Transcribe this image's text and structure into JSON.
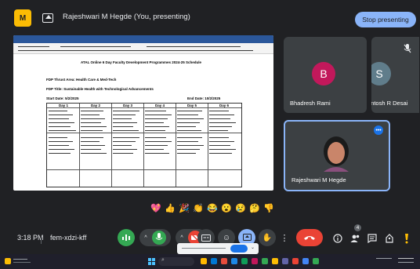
{
  "header": {
    "app_logo_text": "M",
    "presenter_title": "Rajeshwari M Hegde (You, presenting)",
    "stop_presenting_label": "Stop presenting"
  },
  "document": {
    "title": "ATAL Online 6 Day Faculty Development Programmes 2024-25 Schedule",
    "thrust_area": "FDP Thrust Area: Health Care & Med-Tech",
    "fdp_title": "FDP Title: Sustainable Health with Technological Advancements",
    "start_date": "Start Date: 5/2/2025",
    "end_date": "End Date: 10/2/2025",
    "days": [
      "Day 1",
      "Day 2",
      "Day 3",
      "Day 4",
      "Day 5",
      "Day 6"
    ]
  },
  "participants": [
    {
      "name": "Bhadresh Rami",
      "initial": "B",
      "color": "#c2185b"
    },
    {
      "name": "Santosh R Desai",
      "initial": "S",
      "color": "#607d8b"
    },
    {
      "name": "Rajeshwari M Hegde",
      "initial": "",
      "color": "#3c4043"
    }
  ],
  "reactions": [
    "💖",
    "👍",
    "🎉",
    "👏",
    "😂",
    "😮",
    "😢",
    "🤔",
    "👎"
  ],
  "meeting": {
    "time": "3:18 PM",
    "code": "fem-xdzi-kff",
    "participant_count": "4"
  },
  "colors": {
    "accent": "#8ab4f8",
    "end_call": "#ea4335",
    "mic_on": "#34a853",
    "tile": "#3c4043",
    "self_border": "#8ab4f8"
  }
}
